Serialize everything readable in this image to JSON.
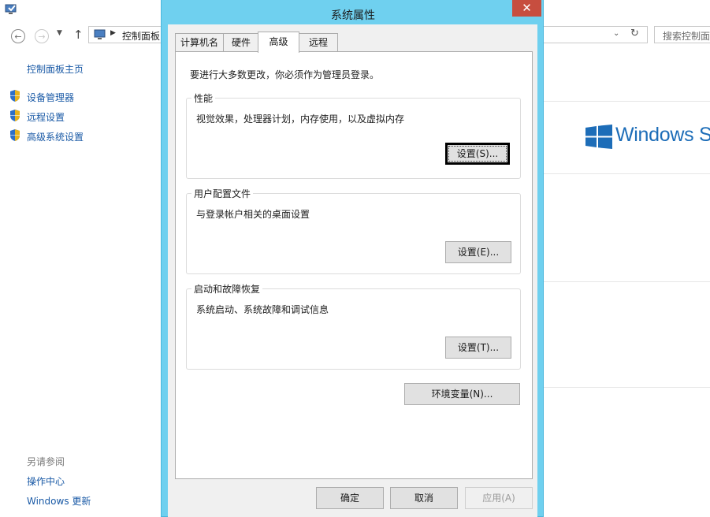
{
  "background_window": {
    "address_path": "控制面板",
    "search_placeholder": "搜索控制面",
    "sidebar": {
      "home": "控制面板主页",
      "items": [
        {
          "label": "设备管理器",
          "icon": "shield-icon"
        },
        {
          "label": "远程设置",
          "icon": "shield-icon"
        },
        {
          "label": "高级系统设置",
          "icon": "shield-icon"
        }
      ],
      "see_also_heading": "另请参阅",
      "see_also": [
        "操作中心",
        "Windows 更新"
      ]
    },
    "brand_text": "Windows Se"
  },
  "dialog": {
    "title": "系统属性",
    "close_glyph": "✕",
    "tabs": [
      {
        "label": "计算机名",
        "selected": false
      },
      {
        "label": "硬件",
        "selected": false
      },
      {
        "label": "高级",
        "selected": true
      },
      {
        "label": "远程",
        "selected": false
      }
    ],
    "admin_note": "要进行大多数更改，你必须作为管理员登录。",
    "groups": {
      "performance": {
        "title": "性能",
        "description": "视觉效果，处理器计划，内存使用，以及虚拟内存",
        "button": "设置(S)..."
      },
      "user_profiles": {
        "title": "用户配置文件",
        "description": "与登录帐户相关的桌面设置",
        "button": "设置(E)..."
      },
      "startup_recovery": {
        "title": "启动和故障恢复",
        "description": "系统启动、系统故障和调试信息",
        "button": "设置(T)..."
      }
    },
    "env_button": "环境变量(N)...",
    "footer": {
      "ok": "确定",
      "cancel": "取消",
      "apply": "应用(A)"
    }
  },
  "colors": {
    "dialog_frame": "#6fd0ef",
    "close_button": "#c74e3f",
    "link": "#1a5aa6",
    "windows_blue": "#1d6db8"
  }
}
